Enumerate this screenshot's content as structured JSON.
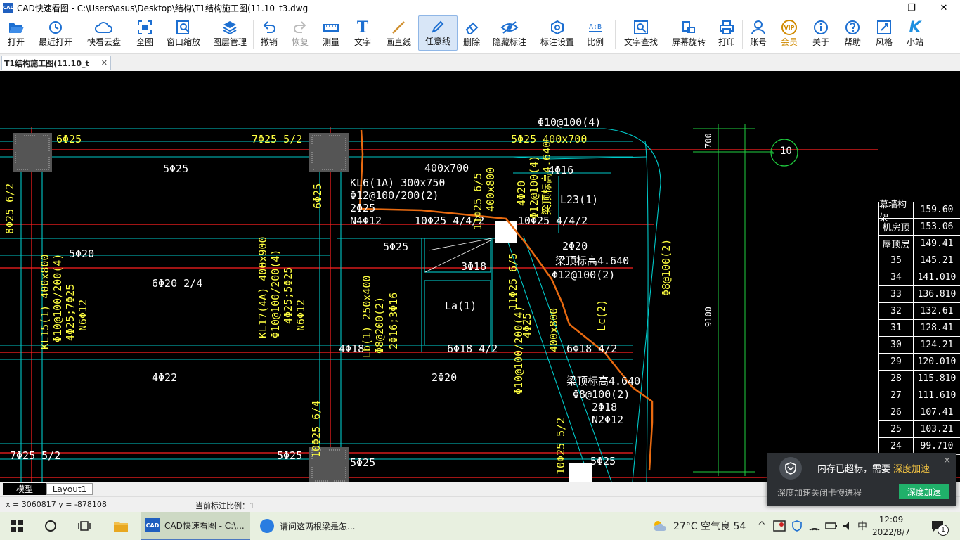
{
  "window": {
    "title": "CAD快速看图 - C:\\Users\\asus\\Desktop\\结构\\T1结构施工图(11.10_t3.dwg",
    "app_icon_text": "CAD",
    "minimize": "—",
    "maximize": "❐",
    "close": "✕"
  },
  "toolbar": [
    {
      "label": "打开",
      "icon": "folder-open-icon"
    },
    {
      "label": "最近打开",
      "icon": "history-icon"
    },
    {
      "label": "快看云盘",
      "icon": "cloud-icon"
    },
    {
      "label": "全图",
      "icon": "fit-all-icon"
    },
    {
      "label": "窗口缩放",
      "icon": "window-zoom-icon"
    },
    {
      "label": "图层管理",
      "icon": "layers-icon"
    },
    {
      "label": "撤销",
      "icon": "undo-icon"
    },
    {
      "label": "恢复",
      "icon": "redo-icon"
    },
    {
      "label": "测量",
      "icon": "measure-icon"
    },
    {
      "label": "文字",
      "icon": "text-icon"
    },
    {
      "label": "画直线",
      "icon": "line-icon"
    },
    {
      "label": "任意线",
      "icon": "pen-icon"
    },
    {
      "label": "删除",
      "icon": "eraser-icon"
    },
    {
      "label": "隐藏标注",
      "icon": "eye-hide-icon"
    },
    {
      "label": "标注设置",
      "icon": "annotation-settings-icon"
    },
    {
      "label": "比例",
      "icon": "scale-icon"
    },
    {
      "label": "文字查找",
      "icon": "text-search-icon"
    },
    {
      "label": "屏幕旋转",
      "icon": "rotate-screen-icon"
    },
    {
      "label": "打印",
      "icon": "print-icon"
    },
    {
      "label": "账号",
      "icon": "user-icon"
    },
    {
      "label": "会员",
      "icon": "vip-icon"
    },
    {
      "label": "关于",
      "icon": "info-icon"
    },
    {
      "label": "帮助",
      "icon": "help-icon"
    },
    {
      "label": "风格",
      "icon": "style-icon"
    },
    {
      "label": "小站",
      "icon": "site-icon"
    }
  ],
  "toolbar_vip_badge": "VIP",
  "toolbar_text_icon": "T",
  "toolbar_scale_icon": "A:B",
  "toolbar_site_icon": "K",
  "doc_tab": {
    "label": "T1结构施工图(11.10_t",
    "close": "✕"
  },
  "cad": {
    "labels_h": [
      "6Φ25",
      "7Φ25 5/2",
      "5Φ25 400x700",
      "Φ10@100(4)",
      "5Φ25",
      "400x700",
      "4Φ16",
      "KL6(1A) 300x750",
      "Φ12@100/200(2)",
      "2Φ25",
      "N4Φ12",
      "10Φ25 4/4/2",
      "10Φ25 4/4/2",
      "L23(1)",
      "5Φ20",
      "5Φ25",
      "3Φ18",
      "2Φ20",
      "梁顶标高4.640",
      "Φ12@100(2)",
      "6Φ20 2/4",
      "La(1)",
      "4Φ18",
      "6Φ18 4/2",
      "6Φ18 4/2",
      "4Φ22",
      "2Φ20",
      "梁顶标高4.640",
      "Φ8@100(2)",
      "2Φ18",
      "N2Φ12",
      "7Φ25 5/2",
      "5Φ25",
      "5Φ25",
      "5Φ25"
    ],
    "labels_v": [
      "8Φ25 6/2",
      "6Φ25",
      "11Φ25 6/5",
      "400x800",
      "4Φ20",
      "Φ12@100(4)",
      "梁顶标高4.640",
      "KL15(1) 400x800",
      "Φ10@100/200(4)",
      "4Φ25;7Φ25",
      "N6Φ12",
      "KL17(4A) 400x900",
      "Φ10@100/200(4)",
      "4Φ25;5Φ25",
      "N6Φ12",
      "Lb(1) 250x400",
      "Φ8@200(2)",
      "2Φ16;3Φ16",
      "11Φ25 6/5",
      "400x800",
      "4Φ25",
      "Φ10@100/200(4)",
      "Lc(2)",
      "Φ8@100(2)",
      "10Φ25 6/4",
      "10Φ25 5/2"
    ],
    "dims": [
      "700",
      "9100"
    ],
    "axis_bubble": "10"
  },
  "elevation_table": [
    [
      "幕墙构架",
      "159.60"
    ],
    [
      "机房顶",
      "153.06"
    ],
    [
      "屋顶层",
      "149.41"
    ],
    [
      "35",
      "145.21"
    ],
    [
      "34",
      "141.010"
    ],
    [
      "33",
      "136.810"
    ],
    [
      "32",
      "132.61"
    ],
    [
      "31",
      "128.41"
    ],
    [
      "30",
      "124.21"
    ],
    [
      "29",
      "120.010"
    ],
    [
      "28",
      "115.810"
    ],
    [
      "27",
      "111.610"
    ],
    [
      "26",
      "107.41"
    ],
    [
      "25",
      "103.21"
    ],
    [
      "24",
      "99.710"
    ]
  ],
  "layout_tabs": {
    "model": "模型",
    "layout": "Layout1"
  },
  "status": {
    "coords": "x = 3060817  y = -878108",
    "scale": "当前标注比例：1"
  },
  "notification": {
    "message_prefix": "内存已超标，需要 ",
    "message_highlight": "深度加速",
    "close": "✕",
    "sub": "深度加速关闭卡慢进程",
    "button": "深度加速"
  },
  "taskbar": {
    "apps": [
      {
        "label": "CAD快速看图 - C:\\...",
        "icon": "cad-app-icon"
      },
      {
        "label": "请问这两根梁是怎...",
        "icon": "browser-icon"
      }
    ],
    "cad_icon_text": "CAD",
    "weather": "27°C  空气良 54",
    "ime": "中",
    "time": "12:09",
    "date": "2022/8/7",
    "notif_count": "1"
  },
  "colors": {
    "canvas_bg": "#000000",
    "cad_text": "#ffff40",
    "beam_line": "#00c8c8",
    "grid_red": "#ff2020",
    "sketch_orange": "#e86a10",
    "dim_green": "#20d040"
  }
}
